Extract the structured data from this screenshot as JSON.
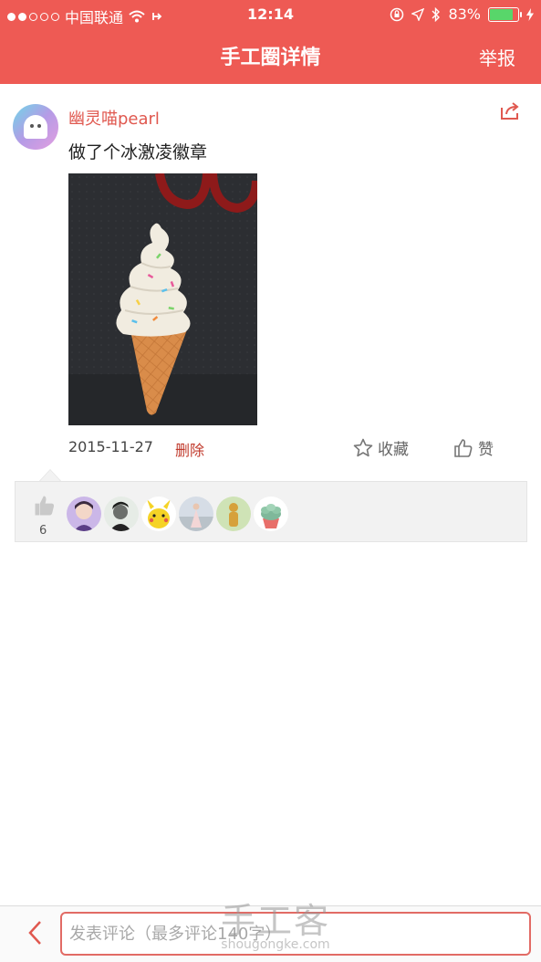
{
  "status_bar": {
    "carrier": "中国联通",
    "time": "12:14",
    "battery": "83%",
    "battery_level": 0.83
  },
  "nav": {
    "title": "手工圈详情",
    "report_label": "举报"
  },
  "post": {
    "username": "幽灵喵pearl",
    "text": "做了个冰激凌徽章",
    "date": "2015-11-27",
    "delete_label": "删除",
    "favorite_label": "收藏",
    "like_label": "赞",
    "image_icon": "ice-cream-badge-photo"
  },
  "likes": {
    "count": "6",
    "avatars": [
      "avatar-girl",
      "avatar-boy",
      "avatar-pikachu",
      "avatar-bride",
      "avatar-gold-figure",
      "avatar-succulent"
    ]
  },
  "comment_bar": {
    "placeholder": "发表评论（最多评论140字）"
  },
  "watermark": {
    "cn": "手工客",
    "en": "shougongke.com"
  },
  "colors": {
    "brand": "#ee5a54",
    "username": "#e0584f",
    "delete": "#c0392b"
  }
}
